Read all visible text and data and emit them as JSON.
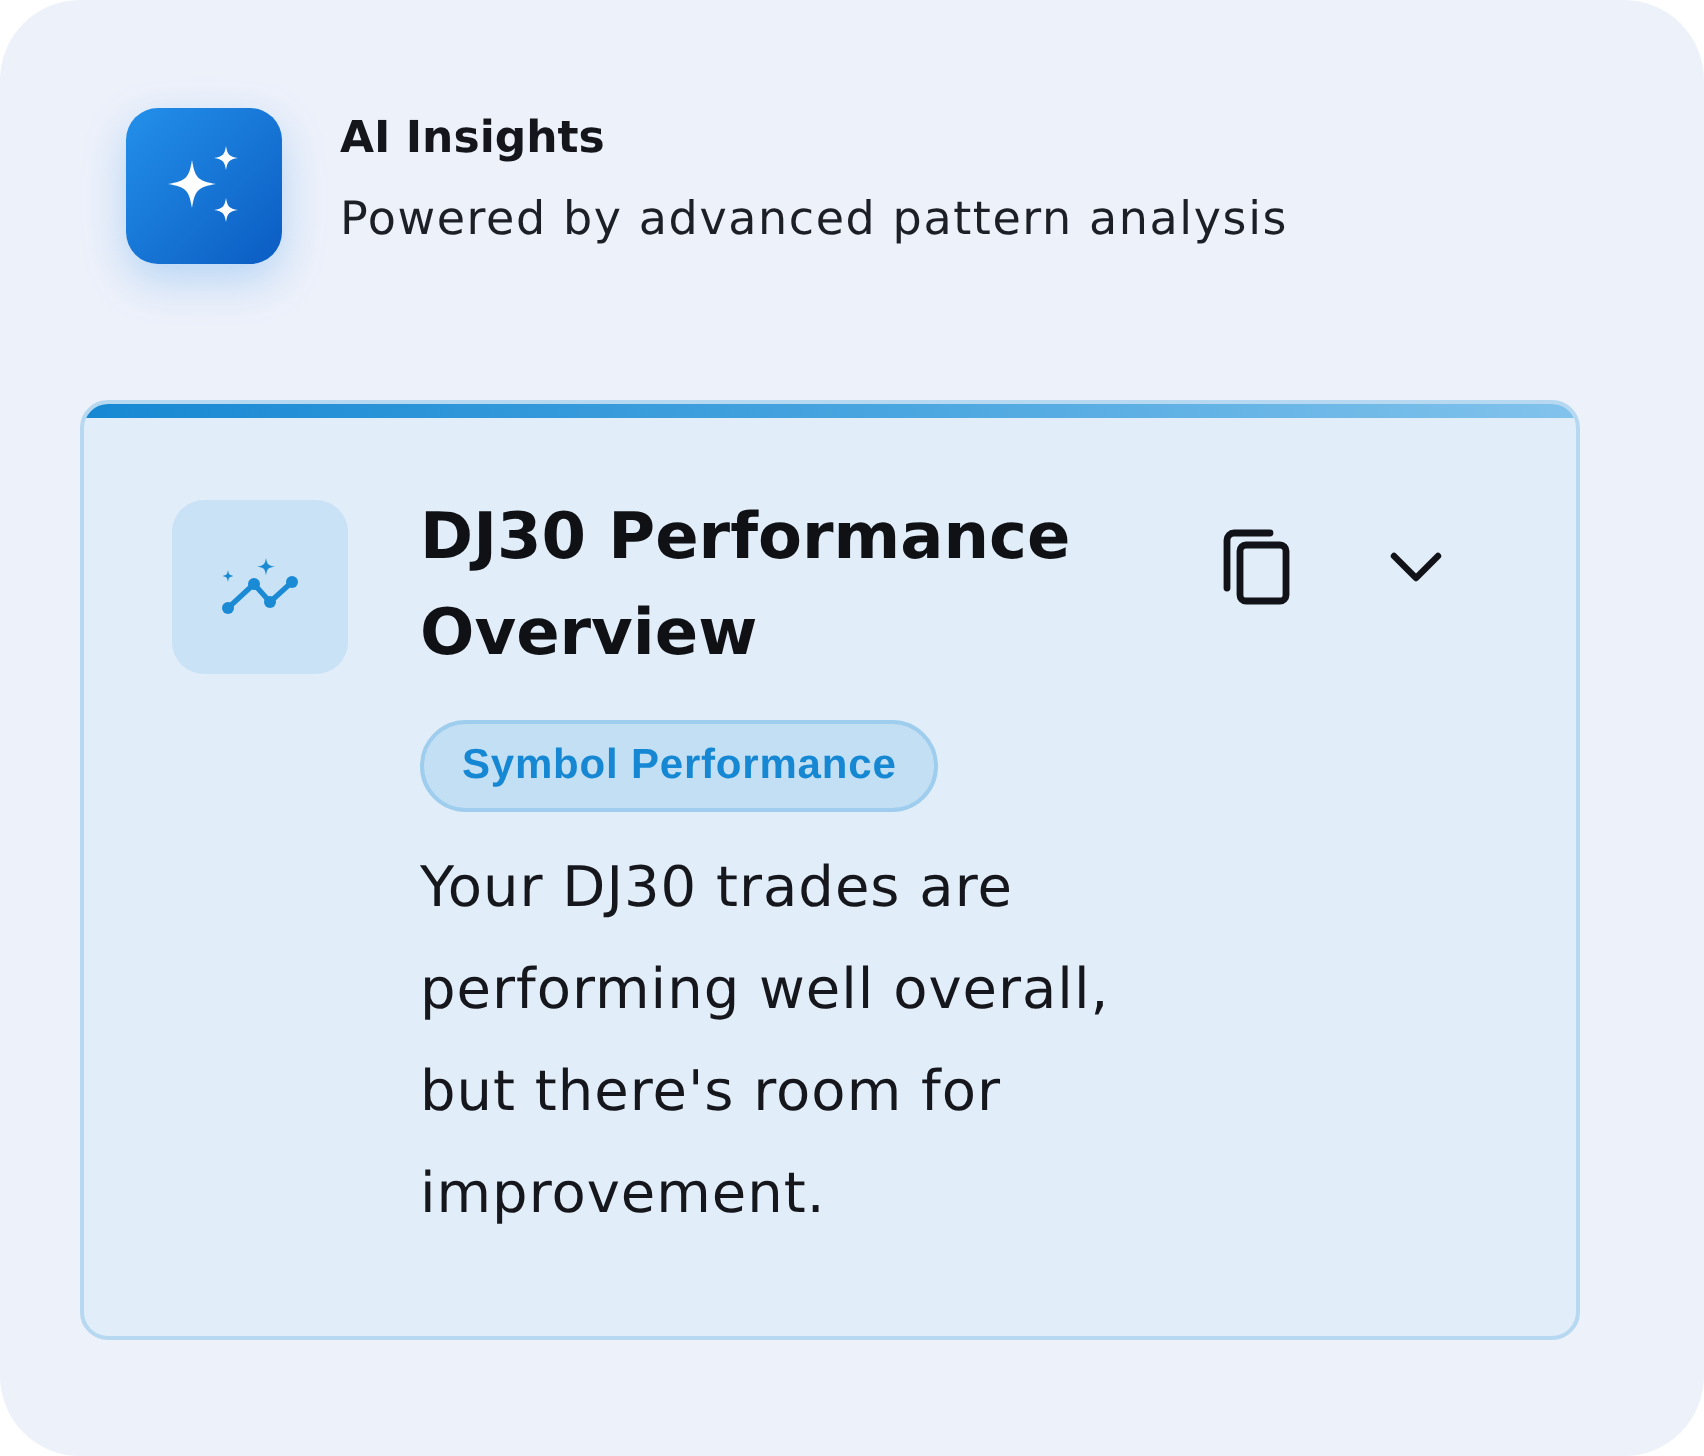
{
  "header": {
    "title": "AI Insights",
    "subtitle": "Powered by advanced pattern analysis"
  },
  "insights": [
    {
      "title": "DJ30 Performance Overview",
      "tag": "Symbol Performance",
      "body": "Your DJ30 trades are performing well overall, but there's room for improvement.",
      "expanded": false
    }
  ]
}
